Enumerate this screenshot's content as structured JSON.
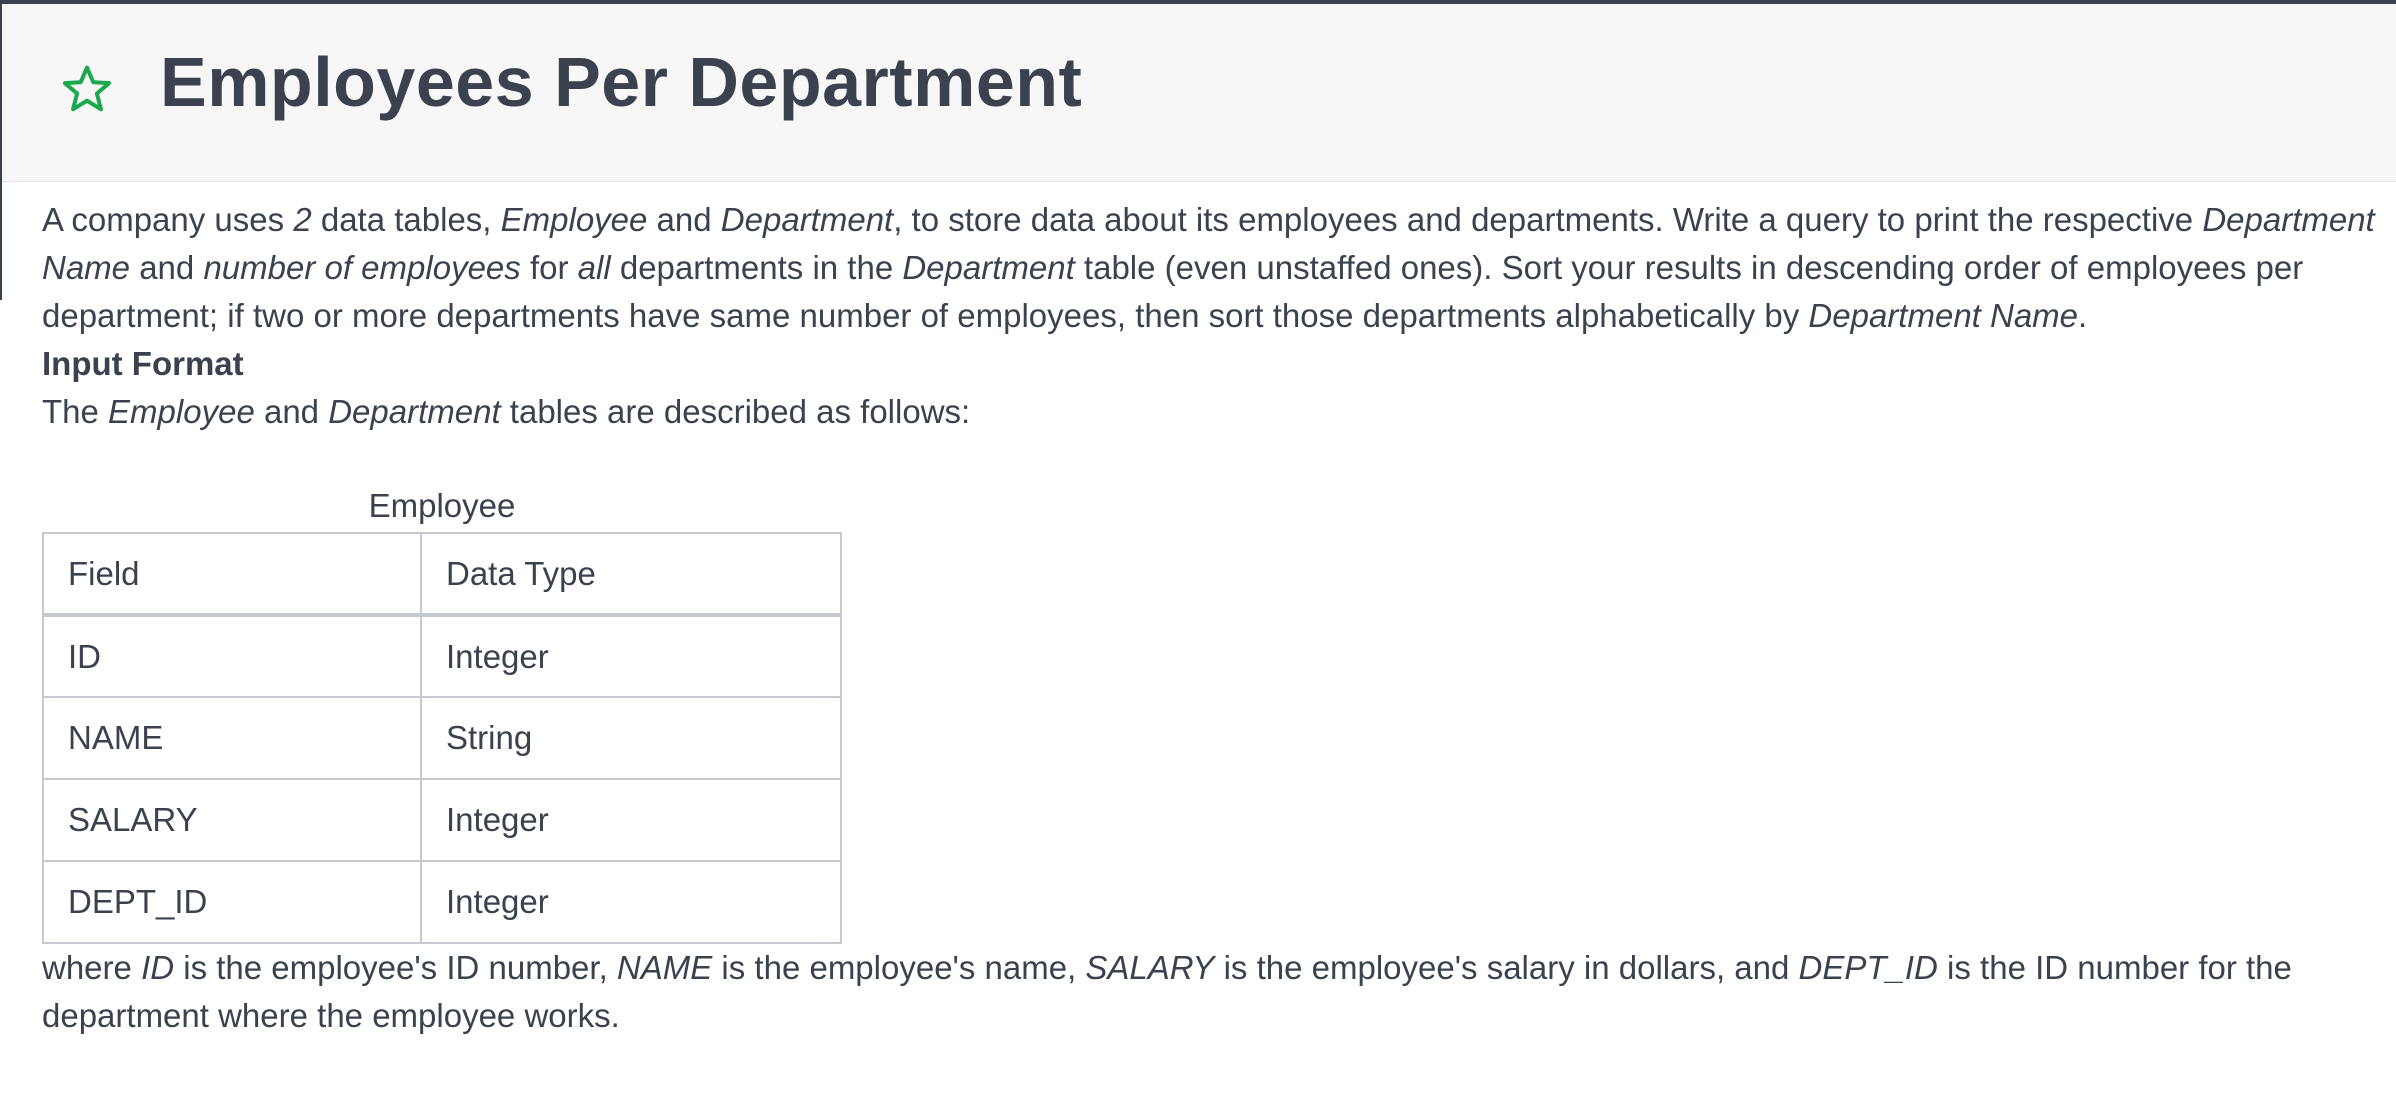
{
  "header": {
    "title": "Employees Per Department",
    "icon": "star-icon",
    "accent_color": "#1ba94c"
  },
  "problem": {
    "para1": {
      "t1": "A company uses ",
      "e1": "2",
      "t2": " data tables, ",
      "e2": "Employee",
      "t3": " and ",
      "e3": "Department",
      "t4": ", to store data about its employees and departments. Write a query to print the respective ",
      "e4": "Department Name",
      "t5": " and ",
      "e5": "number of employees",
      "t6": " for ",
      "e6": "all",
      "t7": " departments in the ",
      "e7": "Department",
      "t8": " table (even unstaffed ones). Sort your results in descending order of employees per department; if two or more departments have same number of employees, then sort those departments alphabetically by ",
      "e8": "Department Name",
      "t9": "."
    },
    "input_format_heading": "Input Format",
    "para2": {
      "t1": "The ",
      "e1": "Employee",
      "t2": " and ",
      "e2": "Department",
      "t3": " tables are described as follows:"
    },
    "table": {
      "caption": "Employee",
      "headers": [
        "Field",
        "Data Type"
      ],
      "rows": [
        [
          "ID",
          "Integer"
        ],
        [
          "NAME",
          "String"
        ],
        [
          "SALARY",
          "Integer"
        ],
        [
          "DEPT_ID",
          "Integer"
        ]
      ]
    },
    "para3": {
      "t1": "where ",
      "e1": "ID",
      "t2": " is the employee's ID number, ",
      "e2": "NAME",
      "t3": " is the employee's name, ",
      "e3": "SALARY",
      "t4": " is the employee's salary in dollars, and ",
      "e4": "DEPT_ID",
      "t5": " is the ID number for the department where the employee works."
    }
  }
}
